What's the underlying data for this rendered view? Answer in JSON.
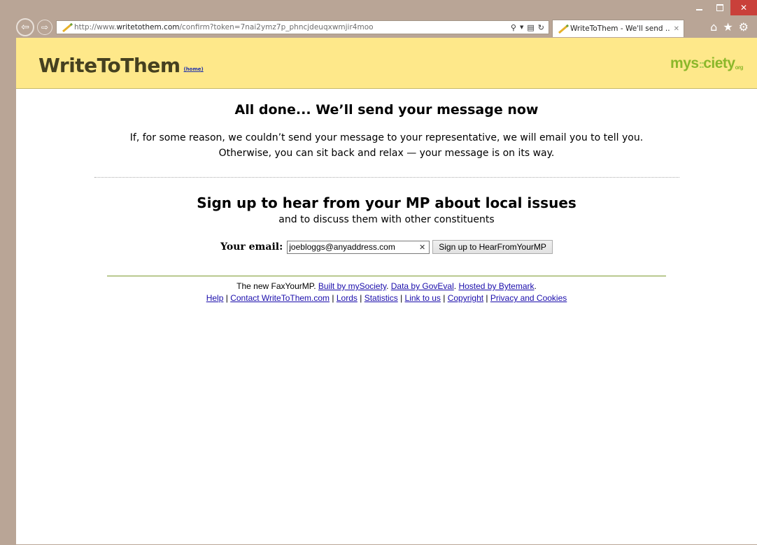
{
  "browser": {
    "url_prefix": "http://www.",
    "url_domain": "writetothem.com",
    "url_rest": "/confirm?token=7nai2ymz7p_phncjdeuqxwmjir4moo",
    "tab_title": "WriteToThem - We'll send ...",
    "icons": [
      "back-arrow-icon",
      "forward-arrow-icon",
      "search-icon",
      "compatibility-icon",
      "refresh-icon",
      "home-icon",
      "favorites-star-icon",
      "gear-icon"
    ]
  },
  "header": {
    "logo": "WriteToThem",
    "home_link": "(home)",
    "partner_logo_pre": "mys",
    "partner_logo_post": "ciety",
    "partner_logo_suffix": "org"
  },
  "main": {
    "heading": "All done... We’ll send your message now",
    "intro_line1": "If, for some reason, we couldn’t send your message to your representative, we will email you to tell you.",
    "intro_line2": "Otherwise, you can sit back and relax — your message is on its way.",
    "signup_heading": "Sign up to hear from your MP about local issues",
    "signup_subheading": "and to discuss them with other constituents",
    "email_label": "Your email:",
    "email_value": "joebloggs@anyaddress.com",
    "signup_button": "Sign up to HearFromYourMP"
  },
  "footer": {
    "line1_text": "The new FaxYourMP.",
    "link_built": "Built by mySociety",
    "link_data": "Data by GovEval",
    "link_hosted": "Hosted by Bytemark",
    "sep": "|",
    "links2": [
      "Help",
      "Contact WriteToThem.com",
      "Lords",
      "Statistics",
      "Link to us",
      "Copyright",
      "Privacy and Cookies"
    ]
  }
}
